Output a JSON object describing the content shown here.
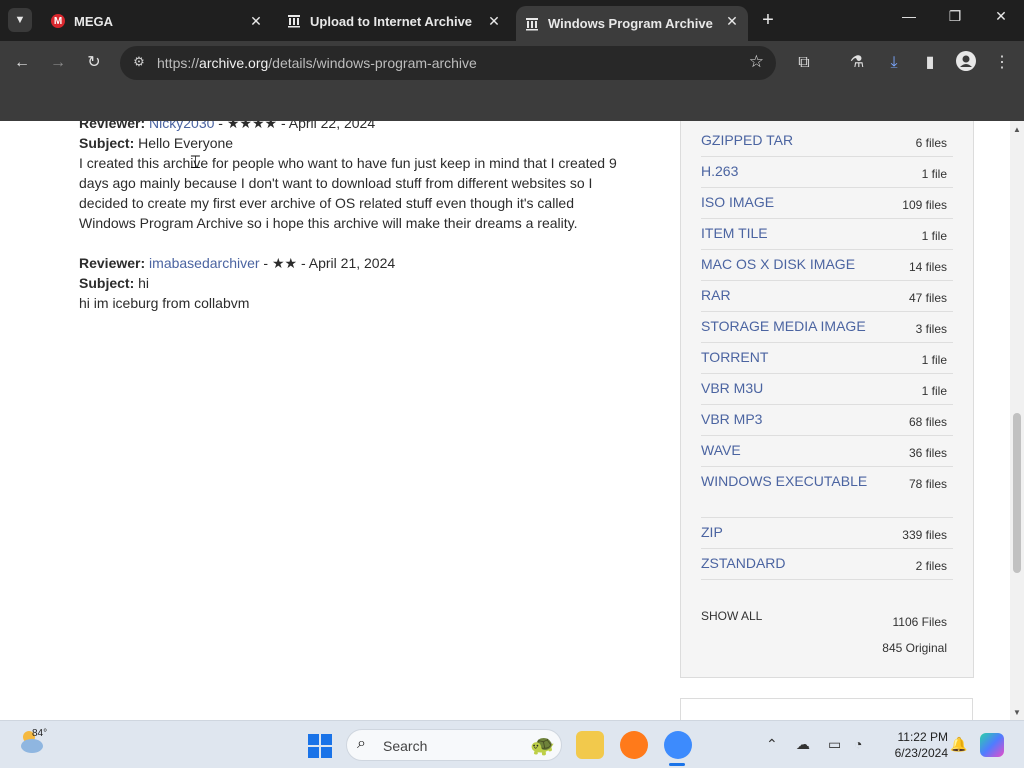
{
  "browser": {
    "tabs": [
      {
        "title": "MEGA",
        "favicon": "mega-icon",
        "active": false
      },
      {
        "title": "Upload to Internet Archive",
        "favicon": "archive-icon",
        "active": false
      },
      {
        "title": "Windows Program Archive : N",
        "favicon": "archive-icon",
        "active": true
      }
    ],
    "url_prefix": "https://",
    "url_host": "archive.org",
    "url_path": "/details/windows-program-archive"
  },
  "reviews": [
    {
      "reviewer_label": "Reviewer:",
      "reviewer": "Nicky2030",
      "meta": " - ★★★★ - April 22, 2024",
      "subject_label": "Subject:",
      "subject": "Hello Everyone",
      "body": "I created this archive for people who want to have fun just keep in mind that I created 9 days ago mainly because I don't want to download stuff from different websites so I decided to create my first ever archive of OS related stuff even though it's called Windows Program Archive so i hope this archive will make their dreams a reality."
    },
    {
      "reviewer_label": "Reviewer:",
      "reviewer": "imabasedarchiver",
      "meta": " - ★★ - April 21, 2024",
      "subject_label": "Subject:",
      "subject": "hi",
      "body": "hi im iceburg from collabvm"
    }
  ],
  "downloads": {
    "formats": [
      {
        "name": "GZIPPED TAR",
        "count": "6 files"
      },
      {
        "name": "H.263",
        "count": "1 file"
      },
      {
        "name": "ISO IMAGE",
        "count": "109 files"
      },
      {
        "name": "ITEM TILE",
        "count": "1 file"
      },
      {
        "name": "MAC OS X DISK IMAGE",
        "count": "14 files"
      },
      {
        "name": "RAR",
        "count": "47 files"
      },
      {
        "name": "STORAGE MEDIA IMAGE",
        "count": "3 files"
      },
      {
        "name": "TORRENT",
        "count": "1 file"
      },
      {
        "name": "VBR M3U",
        "count": "1 file"
      },
      {
        "name": "VBR MP3",
        "count": "68 files"
      },
      {
        "name": "WAVE",
        "count": "36 files"
      },
      {
        "name": "WINDOWS EXECUTABLE",
        "count": "78 files"
      },
      {
        "name": "ZIP",
        "count": "339 files"
      },
      {
        "name": "ZSTANDARD",
        "count": "2 files"
      }
    ],
    "show_all": "SHOW ALL",
    "total_files": "1106 Files",
    "original_files": "845 Original"
  },
  "taskbar": {
    "weather_temp": "84°",
    "search_placeholder": "Search",
    "time": "11:22 PM",
    "date": "6/23/2024"
  },
  "colors": {
    "link": "#4b64a1",
    "tabbar": "#1f1f1f",
    "toolbar": "#3c3c3c"
  }
}
